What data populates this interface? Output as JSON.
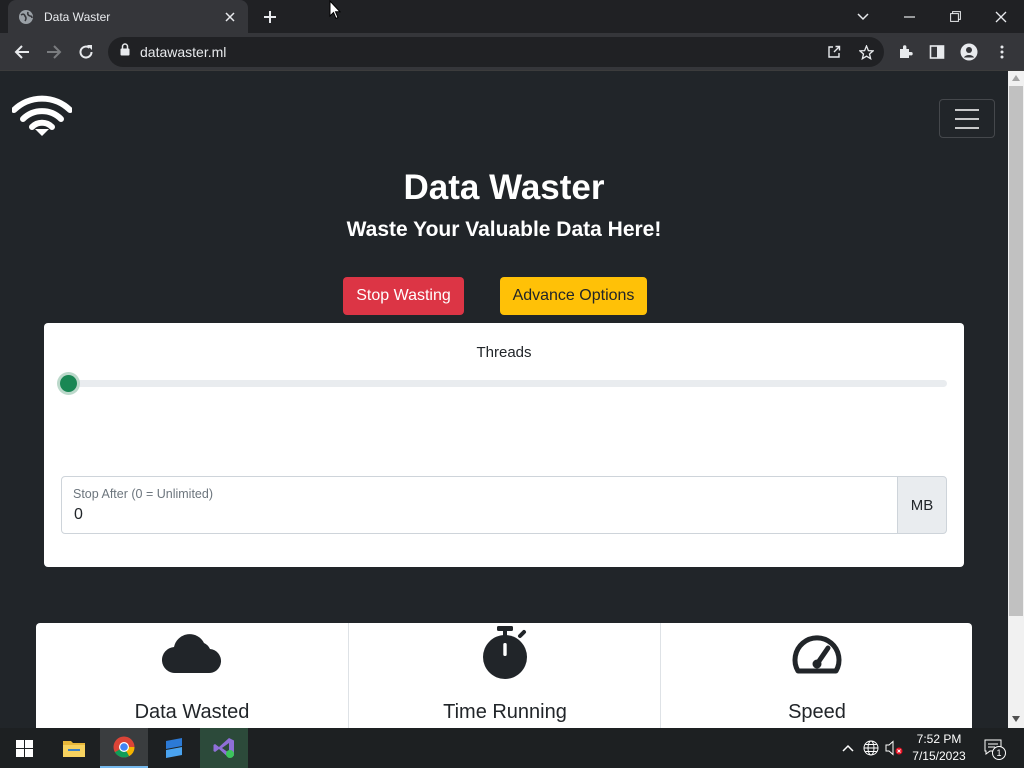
{
  "browser": {
    "tab_title": "Data Waster",
    "url": "datawaster.ml"
  },
  "page": {
    "title": "Data Waster",
    "subtitle": "Waste Your Valuable Data Here!",
    "stop_button": "Stop Wasting",
    "advance_button": "Advance Options",
    "threads_label": "Threads",
    "threads_level_fraction": 0,
    "stop_after_label": "Stop After (0 = Unlimited)",
    "stop_after_value": "0",
    "stop_after_unit": "MB",
    "stats": [
      {
        "label": "Data Wasted",
        "icon": "cloud-icon"
      },
      {
        "label": "Time Running",
        "icon": "stopwatch-icon"
      },
      {
        "label": "Speed",
        "icon": "speedometer-icon"
      }
    ]
  },
  "colors": {
    "danger": "#dc3545",
    "warning": "#ffc107",
    "success": "#198754",
    "page_bg": "#212529"
  },
  "taskbar": {
    "time": "7:52 PM",
    "date": "7/15/2023",
    "notification_count": "1"
  }
}
